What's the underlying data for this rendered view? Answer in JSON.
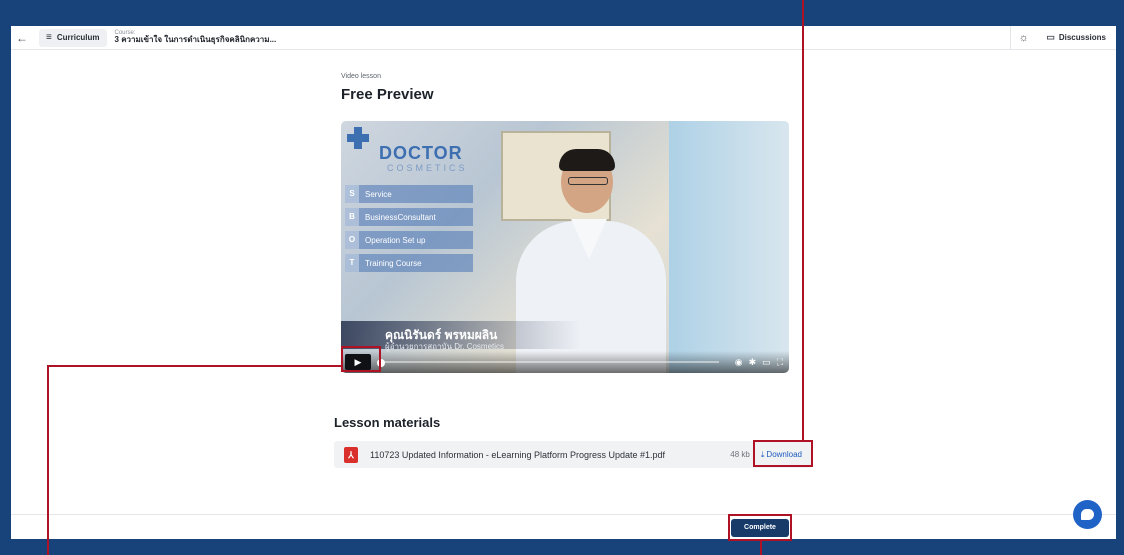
{
  "header": {
    "back_icon": "←",
    "curriculum_label": "Curriculum",
    "course_kicker": "Course:",
    "course_title": "3 ความเข้าใจ ในการดำเนินธุรกิจคลินิกความ...",
    "theme_icon": "☼",
    "discussions_label": "Discussions"
  },
  "lesson": {
    "kicker": "Video lesson",
    "title": "Free Preview"
  },
  "video": {
    "logo_text": "DOCTOR",
    "logo_sub": "COSMETICS",
    "menu": [
      {
        "letter": "S",
        "text": "Service"
      },
      {
        "letter": "B",
        "text": "BusinessConsultant"
      },
      {
        "letter": "O",
        "text": "Operation Set up"
      },
      {
        "letter": "T",
        "text": "Training Course"
      }
    ],
    "speaker_name": "คุณนิรันดร์ พรหมผลิน",
    "speaker_role": "ผู้อำนวยการสถาบัน Dr. Cosmetics",
    "progress": 0.0
  },
  "materials": {
    "title": "Lesson materials",
    "file_name": "110723 Updated Information - eLearning Platform Progress Update #1.pdf",
    "file_size": "48 kb",
    "download_label": "Download"
  },
  "footer": {
    "complete_label": "Complete"
  },
  "colors": {
    "frame": "#17437a",
    "primary_button": "#173a68",
    "link": "#1d5bbf",
    "highlight": "#b01225",
    "pdf": "#d9302c"
  }
}
